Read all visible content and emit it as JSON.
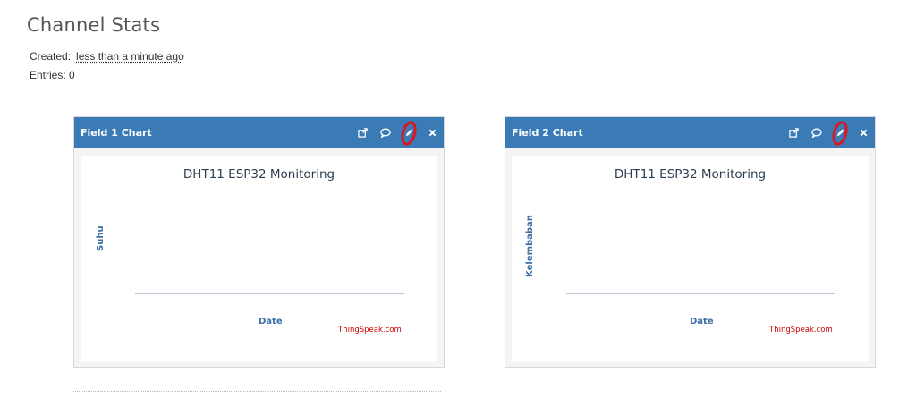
{
  "page": {
    "title": "Channel Stats",
    "created_label": "Created:",
    "created_value": "less than a minute ago",
    "entries_label": "Entries: 0"
  },
  "widgets": [
    {
      "title": "Field 1 Chart",
      "tools": [
        "external-link-icon",
        "comment-icon",
        "pencil-icon",
        "close-icon"
      ],
      "highlighted_tool": "pencil-icon",
      "chart_data": {
        "type": "line",
        "title": "DHT11 ESP32 Monitoring",
        "xlabel": "Date",
        "ylabel": "Suhu",
        "series": [],
        "credit": "ThingSpeak.com"
      }
    },
    {
      "title": "Field 2 Chart",
      "tools": [
        "external-link-icon",
        "comment-icon",
        "pencil-icon",
        "close-icon"
      ],
      "highlighted_tool": "pencil-icon",
      "chart_data": {
        "type": "line",
        "title": "DHT11 ESP32 Monitoring",
        "xlabel": "Date",
        "ylabel": "Kelembaban",
        "series": [],
        "credit": "ThingSpeak.com"
      }
    }
  ],
  "colors": {
    "widget_header": "#3a7bb5",
    "credit": "#cc0000",
    "highlight": "#e0141b"
  }
}
